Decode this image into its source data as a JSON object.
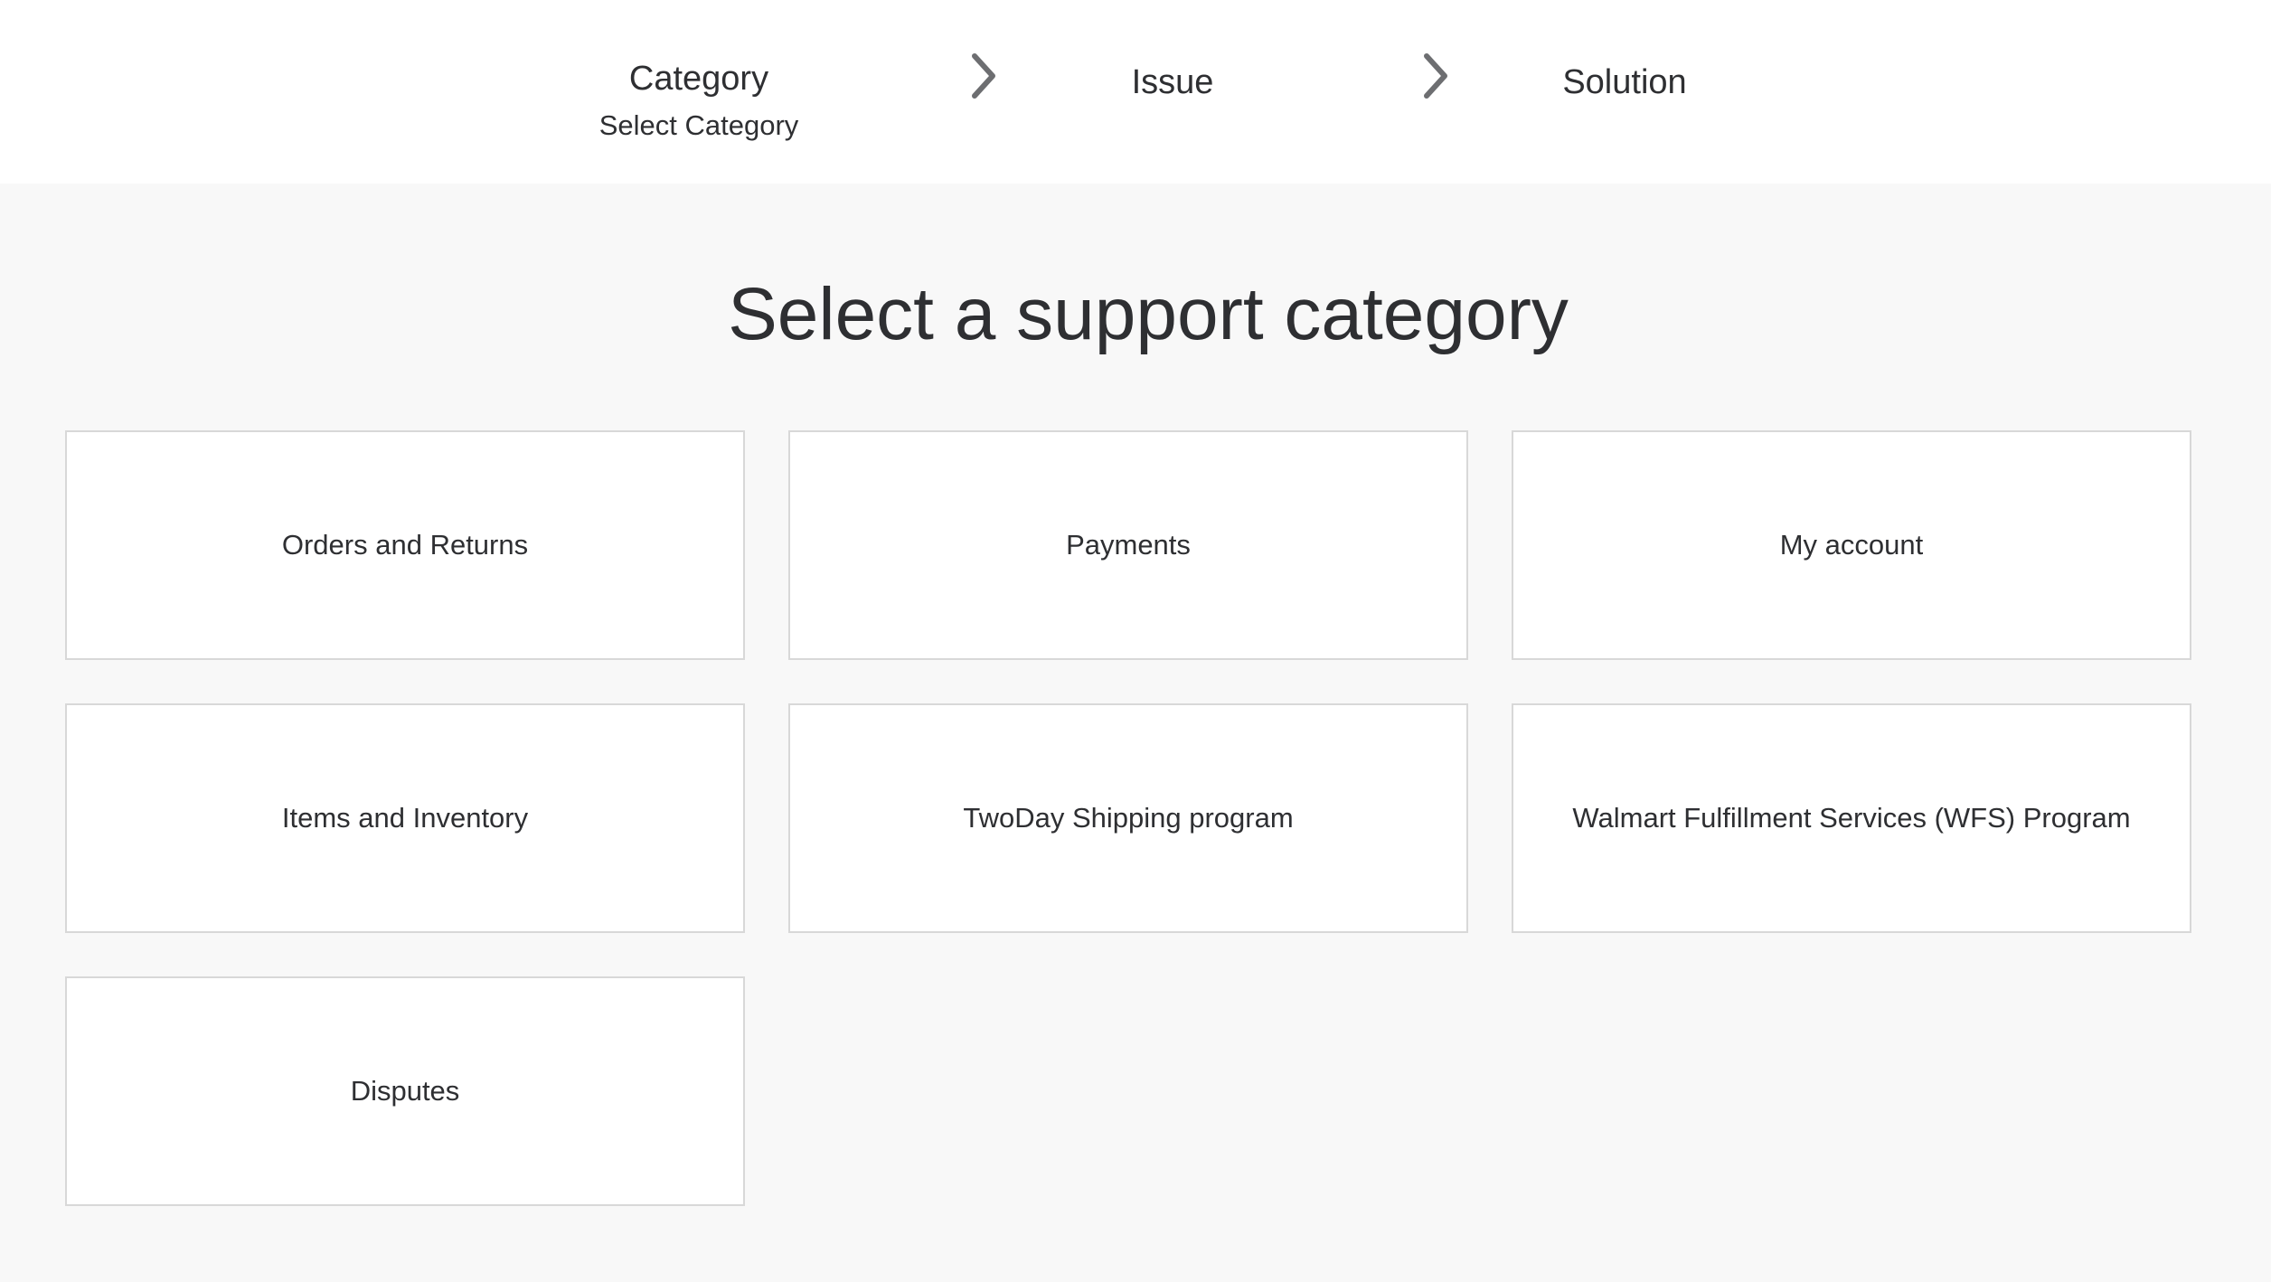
{
  "stepper": {
    "steps": [
      {
        "title": "Category",
        "subtitle": "Select Category"
      },
      {
        "title": "Issue"
      },
      {
        "title": "Solution"
      }
    ]
  },
  "main": {
    "title": "Select a support category",
    "categories": [
      "Orders and Returns",
      "Payments",
      "My account",
      "Items and Inventory",
      "TwoDay Shipping program",
      "Walmart Fulfillment Services (WFS) Program",
      "Disputes"
    ]
  },
  "colors": {
    "text": "#2e2f32",
    "page_background": "#f8f8f8",
    "card_background": "#ffffff",
    "card_border": "#d8d8d8",
    "chevron": "#6d6e71"
  }
}
